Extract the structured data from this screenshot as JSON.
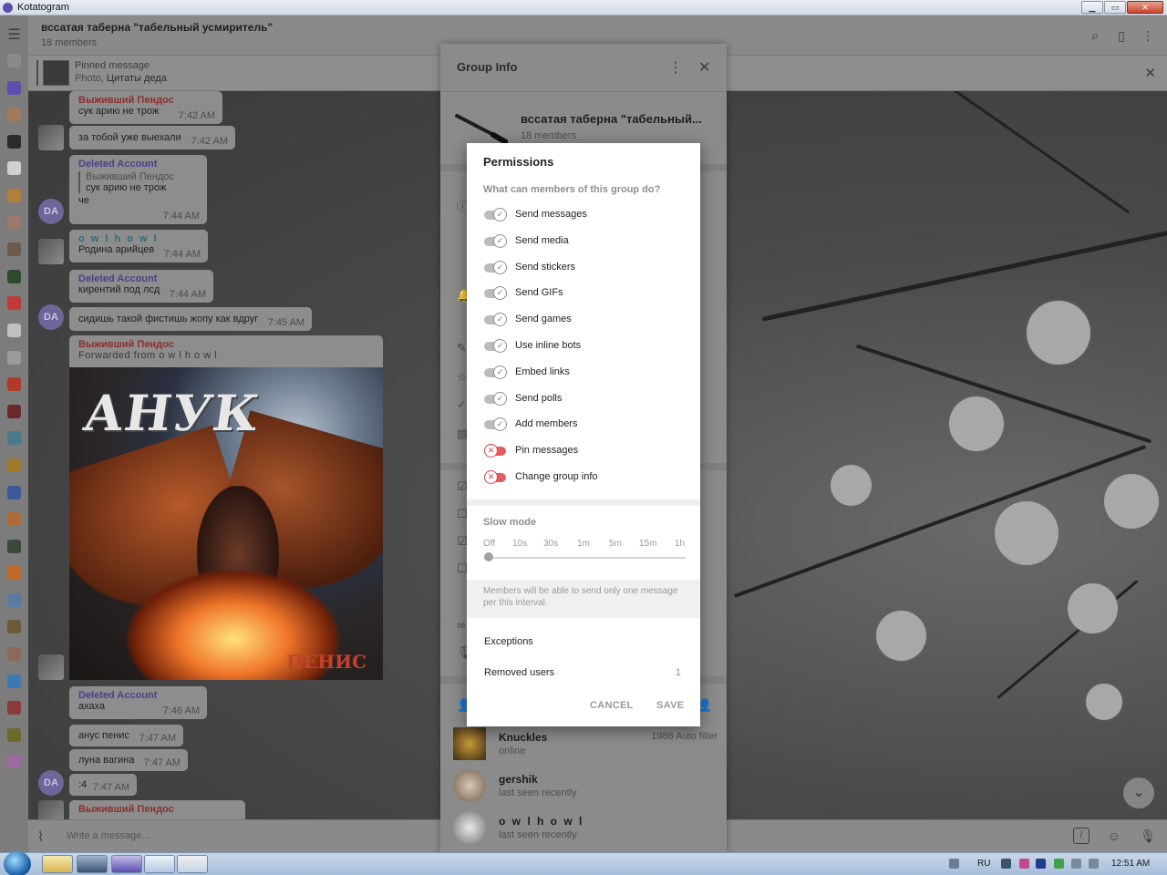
{
  "window": {
    "title": "Kotatogram",
    "minimize": "▁",
    "maximize": "▭",
    "close": "✕"
  },
  "header": {
    "title": "вссатая таберна \"табельный усмиритель\"",
    "subtitle": "18 members"
  },
  "pinned": {
    "label": "Pinned message",
    "type": "Photo,",
    "text": "Цитаты деда"
  },
  "messages": [
    {
      "name": "Выживший Пендос",
      "text": "сук арию не трож",
      "time": "7:42 AM"
    },
    {
      "text": "за тобой уже выехали",
      "time": "7:42 AM"
    },
    {
      "name": "Deleted Account",
      "quote_name": "Выживший Пендос",
      "quote_text": "сук арию не трож",
      "text": "че",
      "time": "7:44 AM"
    },
    {
      "name": "o w l h o w l",
      "text": "Родина арийцев",
      "time": "7:44 AM"
    },
    {
      "name": "Deleted Account",
      "text": "кирентий под лсд",
      "time": "7:44 AM"
    },
    {
      "text": "сидишь такой фистишь жопу как вдруг",
      "time": "7:45 AM"
    },
    {
      "name": "Выживший Пендос",
      "forwarded": "Forwarded from o w l h o w l"
    },
    {
      "name": "Deleted Account",
      "text": "ахаха",
      "time": "7:46 AM"
    },
    {
      "text": "анус пенис",
      "time": "7:47 AM"
    },
    {
      "text": "луна вагина",
      "time": "7:47 AM"
    },
    {
      "text": ":4",
      "time": "7:47 AM"
    },
    {
      "name": "Выживший Пендос"
    }
  ],
  "avatars": {
    "da": "DA"
  },
  "photo": {
    "logo": "АНУК",
    "caption": "ПЕНИС"
  },
  "composer": {
    "placeholder": "Write a message..."
  },
  "group_info": {
    "title": "Group Info",
    "name": "вссатая таберна \"табельный...",
    "members": "18 members",
    "list": [
      {
        "name": "Knuckles",
        "status": "online",
        "role": "1986 Auto filler"
      },
      {
        "name": "gershik",
        "status": "last seen recently",
        "role": ""
      },
      {
        "name": "o w l h o w l",
        "status": "last seen recently",
        "role": ""
      }
    ]
  },
  "dialog": {
    "title": "Permissions",
    "subtitle": "What can members of this group do?",
    "permissions": [
      {
        "label": "Send messages",
        "enabled": true
      },
      {
        "label": "Send media",
        "enabled": true
      },
      {
        "label": "Send stickers",
        "enabled": true
      },
      {
        "label": "Send GIFs",
        "enabled": true
      },
      {
        "label": "Send games",
        "enabled": true
      },
      {
        "label": "Use inline bots",
        "enabled": true
      },
      {
        "label": "Embed links",
        "enabled": true
      },
      {
        "label": "Send polls",
        "enabled": true
      },
      {
        "label": "Add members",
        "enabled": true
      },
      {
        "label": "Pin messages",
        "enabled": false
      },
      {
        "label": "Change group info",
        "enabled": false
      }
    ],
    "slow_mode": {
      "title": "Slow mode",
      "ticks": [
        "Off",
        "10s",
        "30s",
        "1m",
        "5m",
        "15m",
        "1h"
      ],
      "selected": "Off",
      "note": "Members will be able to send only one message per this interval."
    },
    "exceptions": "Exceptions",
    "removed_users": "Removed users",
    "removed_count": "1",
    "cancel": "CANCEL",
    "save": "SAVE"
  },
  "taskbar": {
    "lang": "RU",
    "time": "12:51 AM"
  }
}
